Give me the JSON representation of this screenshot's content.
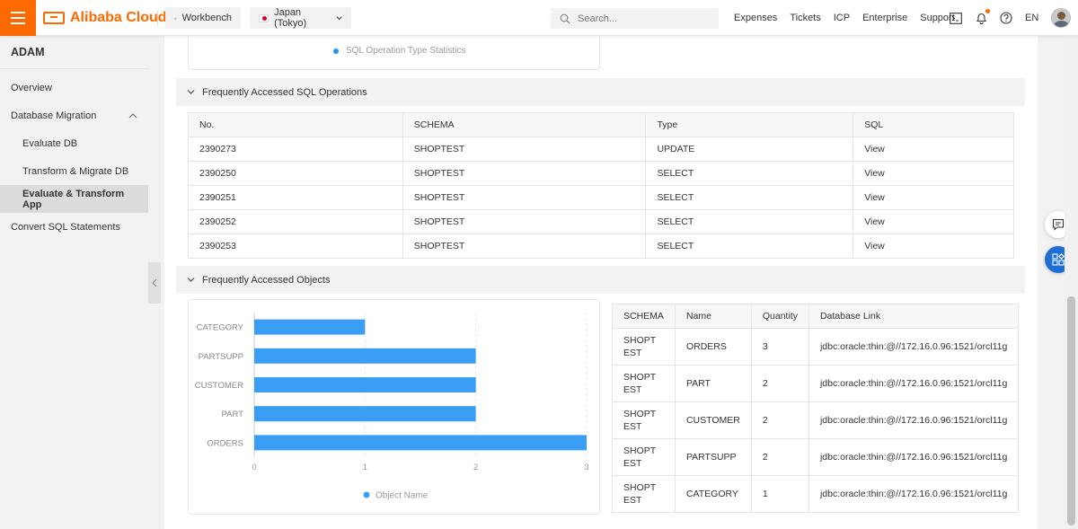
{
  "header": {
    "logo_text": "Alibaba Cloud",
    "workbench_label": "Workbench",
    "region_label": "Japan (Tokyo)",
    "search_placeholder": "Search...",
    "links": [
      "Expenses",
      "Tickets",
      "ICP",
      "Enterprise",
      "Support"
    ],
    "lang": "EN",
    "brand_color": "#ff6a00"
  },
  "sidebar": {
    "title": "ADAM",
    "items": [
      {
        "label": "Overview"
      },
      {
        "label": "Database Migration"
      },
      {
        "label": "Evaluate DB"
      },
      {
        "label": "Transform & Migrate DB"
      },
      {
        "label": "Evaluate & Transform App"
      },
      {
        "label": "Convert SQL Statements"
      }
    ]
  },
  "top_chart": {
    "legend": "SQL Operation Type Statistics"
  },
  "sql_section": {
    "title": "Frequently Accessed SQL Operations",
    "columns": [
      "No.",
      "SCHEMA",
      "Type",
      "SQL"
    ],
    "rows": [
      [
        "2390273",
        "SHOPTEST",
        "UPDATE",
        "View"
      ],
      [
        "2390250",
        "SHOPTEST",
        "SELECT",
        "View"
      ],
      [
        "2390251",
        "SHOPTEST",
        "SELECT",
        "View"
      ],
      [
        "2390252",
        "SHOPTEST",
        "SELECT",
        "View"
      ],
      [
        "2390253",
        "SHOPTEST",
        "SELECT",
        "View"
      ]
    ]
  },
  "objects_section": {
    "title": "Frequently Accessed Objects",
    "columns": [
      "SCHEMA",
      "Name",
      "Quantity",
      "Database Link"
    ],
    "rows": [
      [
        "SHOPTEST",
        "ORDERS",
        "3",
        "jdbc:oracle:thin:@//172.16.0.96:1521/orcl11g"
      ],
      [
        "SHOPTEST",
        "PART",
        "2",
        "jdbc:oracle:thin:@//172.16.0.96:1521/orcl11g"
      ],
      [
        "SHOPTEST",
        "CUSTOMER",
        "2",
        "jdbc:oracle:thin:@//172.16.0.96:1521/orcl11g"
      ],
      [
        "SHOPTEST",
        "PARTSUPP",
        "2",
        "jdbc:oracle:thin:@//172.16.0.96:1521/orcl11g"
      ],
      [
        "SHOPTEST",
        "CATEGORY",
        "1",
        "jdbc:oracle:thin:@//172.16.0.96:1521/orcl11g"
      ]
    ]
  },
  "chart_data": {
    "type": "bar",
    "orientation": "horizontal",
    "categories": [
      "CATEGORY",
      "PARTSUPP",
      "CUSTOMER",
      "PART",
      "ORDERS"
    ],
    "series": [
      {
        "name": "Object Name",
        "values": [
          1,
          2,
          2,
          2,
          3
        ]
      }
    ],
    "xlim": [
      0,
      3
    ],
    "xticks": [
      "0",
      "1",
      "2",
      "3"
    ],
    "legend_position": "bottom",
    "bar_color": "#3b9ef5",
    "grid": true
  }
}
